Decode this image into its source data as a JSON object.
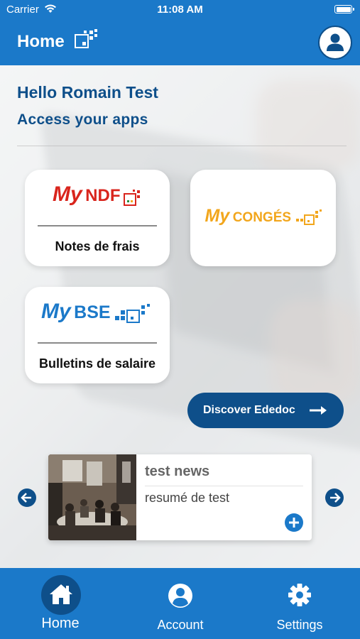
{
  "status_bar": {
    "carrier": "Carrier",
    "time": "11:08 AM"
  },
  "header": {
    "title": "Home"
  },
  "greeting": "Hello Romain Test",
  "subheading": "Access your apps",
  "apps": [
    {
      "brand_my": "My",
      "brand_name": "NDF",
      "label": "Notes de frais",
      "color": "#d9251d"
    },
    {
      "brand_my": "My",
      "brand_name": "CONGÉS",
      "label": "",
      "color": "#f2a61c"
    },
    {
      "brand_my": "My",
      "brand_name": "BSE",
      "label": "Bulletins de salaire",
      "color": "#1b79c9"
    }
  ],
  "discover_button": "Discover Ededoc",
  "news": {
    "title": "test news",
    "summary": "resumé de test"
  },
  "tab_bar": {
    "home": "Home",
    "account": "Account",
    "settings": "Settings"
  },
  "colors": {
    "primary": "#1b79c9",
    "dark": "#0e4f8a",
    "ndf": "#d9251d",
    "conges": "#f2a61c"
  }
}
